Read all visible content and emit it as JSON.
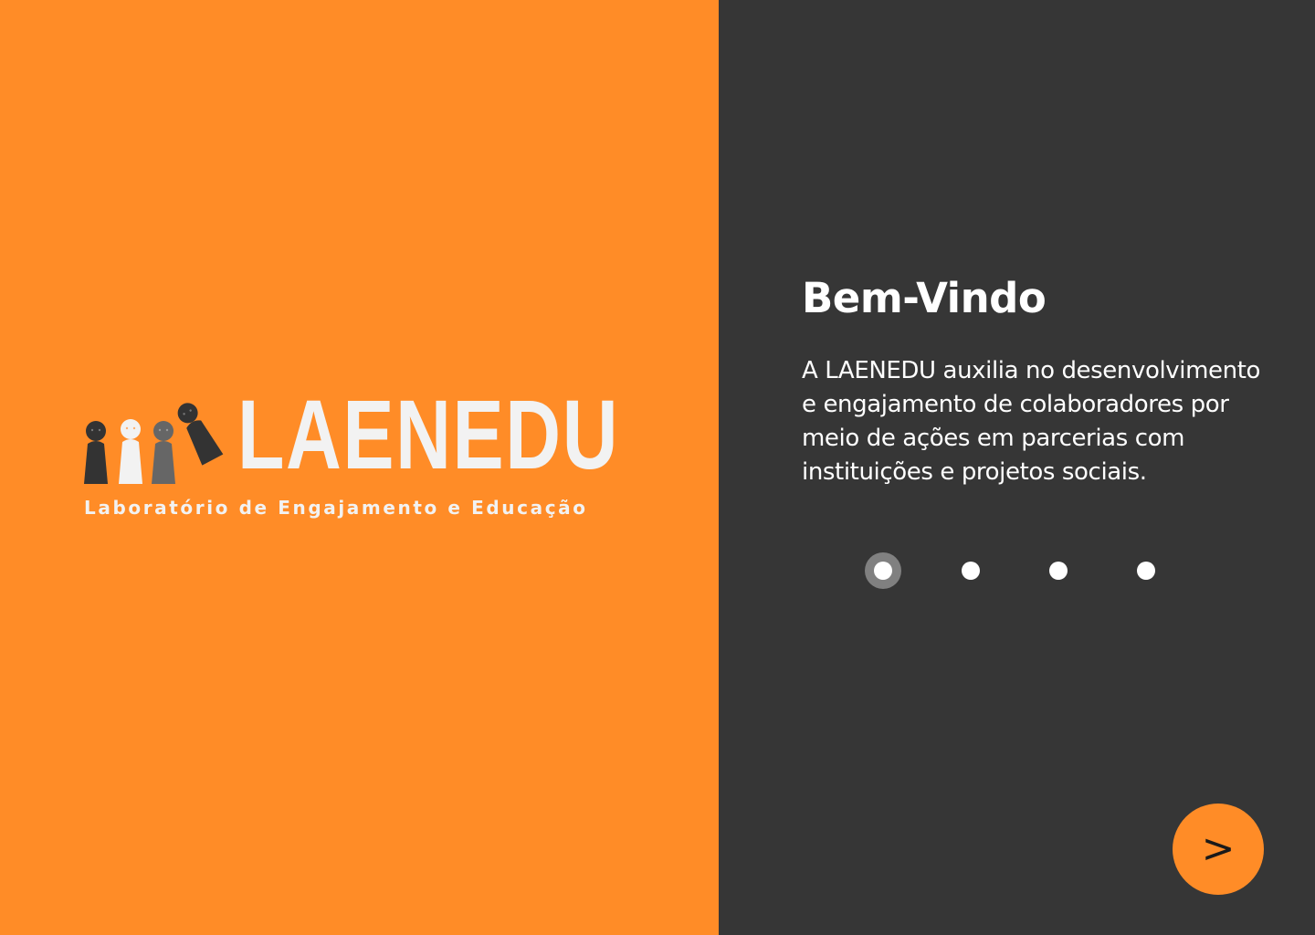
{
  "brand": {
    "name": "LAENEDU",
    "tagline": "Laboratório de Engajamento e Educação",
    "logo_icon": "people-figures-icon"
  },
  "welcome": {
    "title": "Bem-Vindo",
    "description": "A LAENEDU auxilia no desenvolvimento e engajamento de colaboradores por meio de ações em parcerias com instituições e projetos sociais."
  },
  "carousel": {
    "total_steps": 4,
    "current_step": 1
  },
  "navigation": {
    "next_label": ">"
  },
  "colors": {
    "accent_orange": "#FF8C27",
    "panel_dark": "#363636",
    "text_light": "#FFFFFF",
    "logo_text": "#F2F2F2",
    "active_dot_ring": "#808080"
  }
}
